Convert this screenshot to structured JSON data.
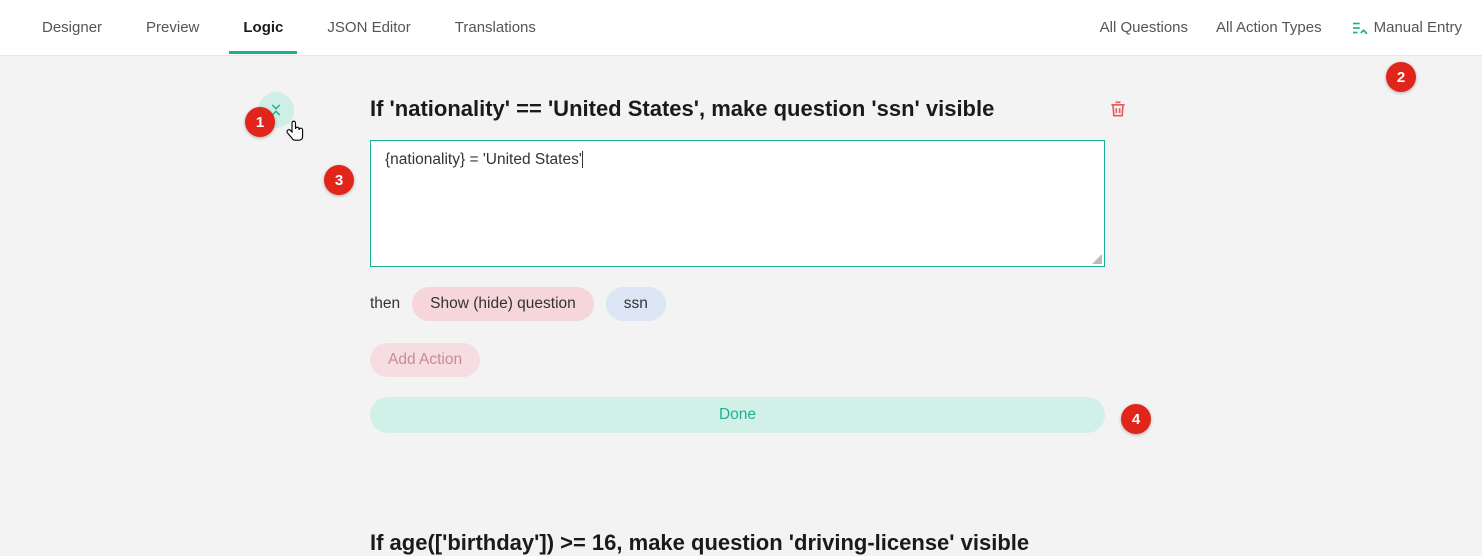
{
  "tabs": {
    "designer": "Designer",
    "preview": "Preview",
    "logic": "Logic",
    "json_editor": "JSON Editor",
    "translations": "Translations"
  },
  "filters": {
    "all_questions": "All Questions",
    "all_action_types": "All Action Types",
    "manual_entry": "Manual Entry"
  },
  "rule1": {
    "title": "If 'nationality' == 'United States', make question 'ssn' visible",
    "expression": "{nationality} = 'United States'",
    "then_label": "then",
    "action_pill": "Show (hide) question",
    "question_pill": "ssn"
  },
  "buttons": {
    "add_action": "Add Action",
    "done": "Done"
  },
  "rule2": {
    "title": "If age(['birthday']) >= 16, make question 'driving-license' visible"
  },
  "badges": {
    "b1": "1",
    "b2": "2",
    "b3": "3",
    "b4": "4"
  }
}
